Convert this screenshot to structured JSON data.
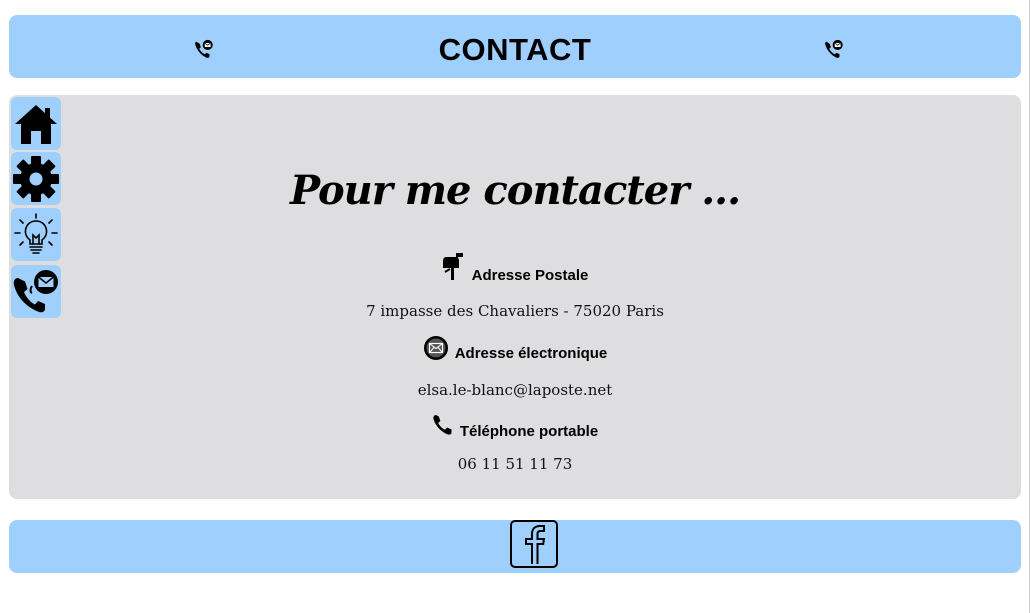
{
  "header": {
    "title": "CONTACT",
    "left_icon": "phone-mail-icon",
    "right_icon": "phone-mail-icon"
  },
  "sidebar": {
    "items": [
      {
        "icon": "home-icon"
      },
      {
        "icon": "gear-icon"
      },
      {
        "icon": "lightbulb-icon"
      },
      {
        "icon": "phone-mail-icon"
      }
    ]
  },
  "main": {
    "heading": "Pour me contacter ...",
    "postal": {
      "icon": "mailbox-icon",
      "label": "Adresse Postale",
      "value": "7 impasse des Chavaliers - 75020 Paris"
    },
    "email": {
      "icon": "envelope-circle-icon",
      "label": "Adresse électronique",
      "value": "elsa.le-blanc@laposte.net"
    },
    "phone": {
      "icon": "phone-icon",
      "label": "Téléphone portable",
      "value": "06 11 51 11 73"
    }
  },
  "footer": {
    "icon": "facebook-icon"
  },
  "colors": {
    "bar": "#9fcffd",
    "panel": "#dedee0"
  }
}
